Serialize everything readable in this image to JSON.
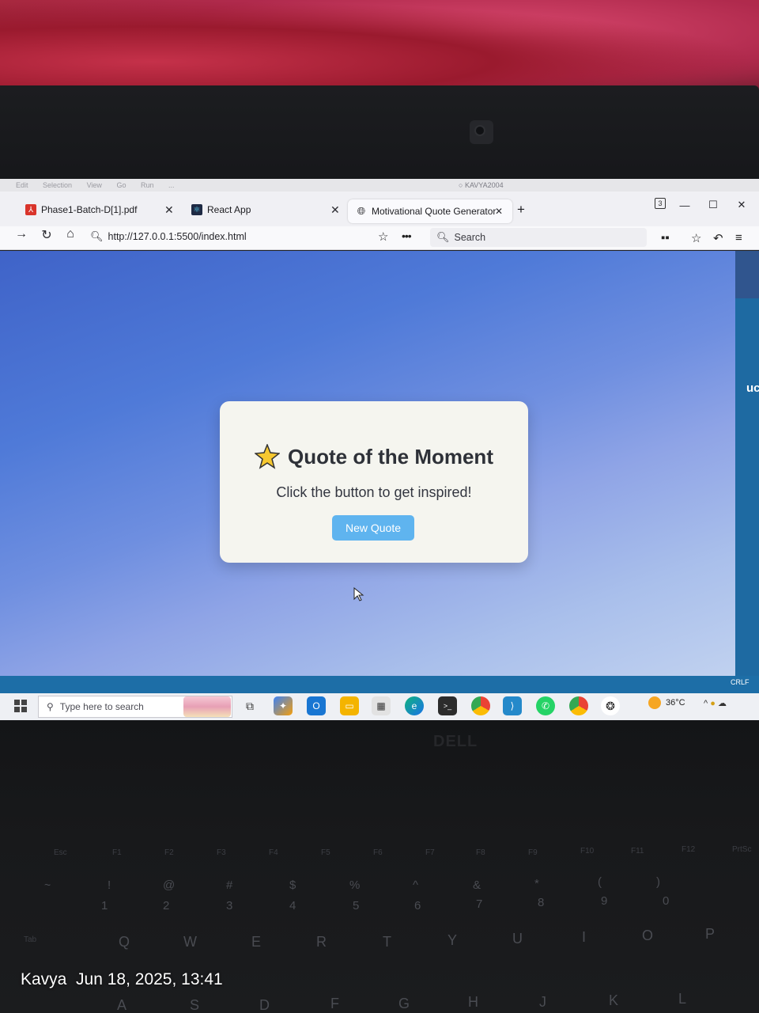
{
  "vscode": {
    "menu": [
      "Edit",
      "Selection",
      "View",
      "Go",
      "Run",
      "..."
    ],
    "profile_title": "KAVYA2004"
  },
  "browser": {
    "tabs": [
      {
        "label": "Phase1-Batch-D[1].pdf",
        "icon": "pdf-icon"
      },
      {
        "label": "React App",
        "icon": "react-icon"
      },
      {
        "label": "Motivational Quote Generator",
        "icon": "globe-icon",
        "active": true
      }
    ],
    "new_tab": "+",
    "url": "http://127.0.0.1:5500/index.html",
    "search_placeholder": "Search",
    "badge": "3",
    "window_controls": {
      "minimize": "—",
      "maximize": "☐",
      "close": "✕"
    }
  },
  "page": {
    "title": "Quote of the Moment",
    "subtitle": "Click the button to get inspired!",
    "button_label": "New Quote",
    "accent_color": "#5fb4ef"
  },
  "editor": {
    "right_text": "uc",
    "line_ending": "CRLF"
  },
  "taskbar": {
    "search_placeholder": "Type here to search",
    "weather": "36°C",
    "apps": [
      "task-view-icon",
      "copilot-icon",
      "outlook-icon",
      "file-explorer-icon",
      "store-icon",
      "edge-icon",
      "terminal-icon",
      "chrome-icon",
      "vscode-icon",
      "whatsapp-icon",
      "chrome-alt-icon",
      "chatgpt-icon"
    ]
  },
  "keyboard": {
    "fn_row": [
      "Esc",
      "F1",
      "F2",
      "F3",
      "F4",
      "F5",
      "F6",
      "F7",
      "F8",
      "F9",
      "F10",
      "F11",
      "F12",
      "PrtSc"
    ],
    "num_row_top": [
      "~",
      "!",
      "@",
      "#",
      "$",
      "%",
      "^",
      "&",
      "*",
      "(",
      ")"
    ],
    "num_row": [
      "1",
      "2",
      "3",
      "4",
      "5",
      "6",
      "7",
      "8",
      "9",
      "0"
    ],
    "top_row": [
      "Tab",
      "Q",
      "W",
      "E",
      "R",
      "T",
      "Y",
      "U",
      "I",
      "O",
      "P"
    ],
    "home_row": [
      "A",
      "S",
      "D",
      "F",
      "G",
      "H",
      "J",
      "K",
      "L"
    ]
  },
  "photo_caption": {
    "name": "Kavya",
    "datetime": "Jun 18, 2025, 13:41"
  }
}
